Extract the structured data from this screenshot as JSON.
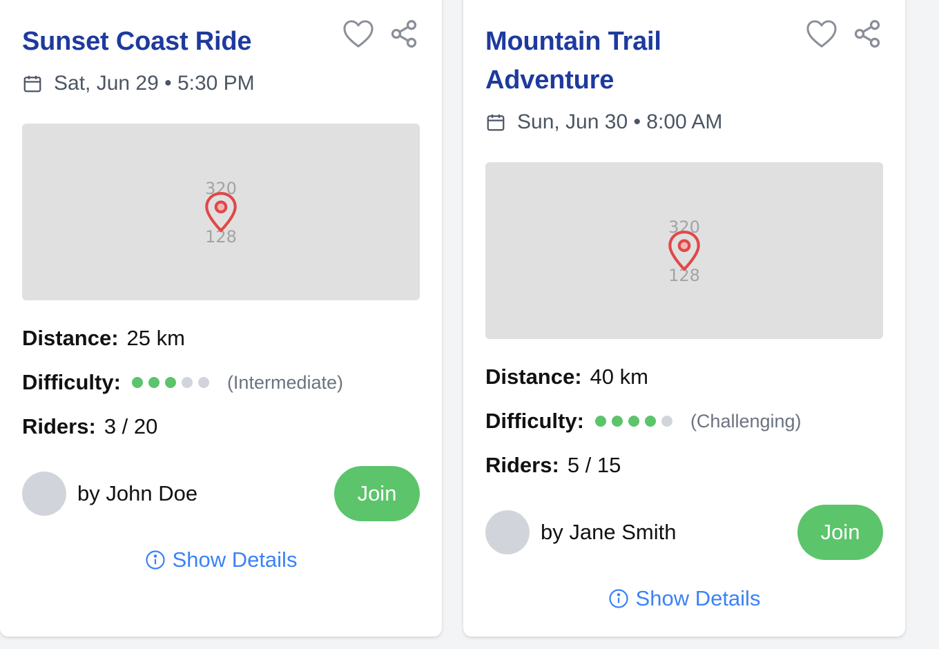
{
  "rides": [
    {
      "title": "Sunset Coast Ride",
      "date": "Sat, Jun 29 • 5:30 PM",
      "map": {
        "label_top": "320",
        "label_bottom": "128"
      },
      "distance_label": "Distance:",
      "distance": "25 km",
      "difficulty_label": "Difficulty:",
      "difficulty_level": 3,
      "difficulty_max": 5,
      "difficulty_text": "(Intermediate)",
      "riders_label": "Riders:",
      "riders": "3 / 20",
      "organizer": "by John Doe",
      "join_label": "Join",
      "details_label": "Show Details"
    },
    {
      "title": "Mountain Trail Adventure",
      "date": "Sun, Jun 30 • 8:00 AM",
      "map": {
        "label_top": "320",
        "label_bottom": "128"
      },
      "distance_label": "Distance:",
      "distance": "40 km",
      "difficulty_label": "Difficulty:",
      "difficulty_level": 4,
      "difficulty_max": 5,
      "difficulty_text": "(Challenging)",
      "riders_label": "Riders:",
      "riders": "5 / 15",
      "organizer": "by Jane Smith",
      "join_label": "Join",
      "details_label": "Show Details"
    }
  ],
  "icons": {
    "favorite": "heart-outline-icon",
    "share": "share-icon",
    "date": "calendar-icon",
    "map_pin": "map-pin-icon",
    "info": "info-circle-icon"
  },
  "colors": {
    "title": "#1e3a9e",
    "join_button": "#5cc46b",
    "difficulty_on": "#5cc46b",
    "difficulty_off": "#d1d5db",
    "link": "#3b82f6",
    "pin": "#e04848",
    "map_bg": "#e0e0e0"
  }
}
